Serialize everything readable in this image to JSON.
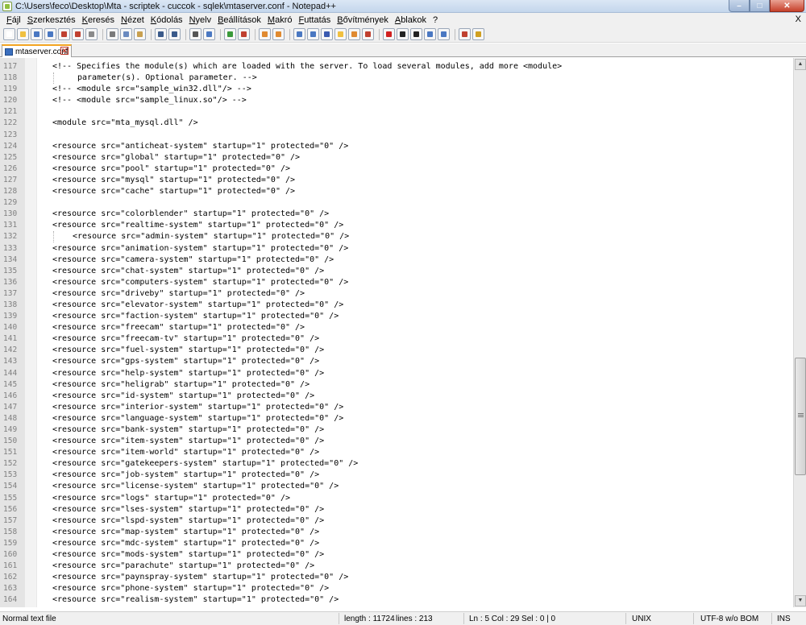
{
  "window": {
    "title": "C:\\Users\\feco\\Desktop\\Mta - scriptek - cuccok - sqlek\\mtaserver.conf - Notepad++",
    "min_glyph": "–",
    "max_glyph": "□",
    "close_glyph": "✕"
  },
  "menu": {
    "items": [
      "Fájl",
      "Szerkesztés",
      "Keresés",
      "Nézet",
      "Kódolás",
      "Nyelv",
      "Beállítások",
      "Makró",
      "Futtatás",
      "Bővítmények",
      "Ablakok",
      "?"
    ],
    "close_label": "X"
  },
  "tab": {
    "label": "mtaserver.conf",
    "close_glyph": "✕"
  },
  "editor": {
    "lines": [
      {
        "n": "117",
        "text": "<!-- Specifies the module(s) which are loaded with the server. To load several modules, add more <module>",
        "style": "code"
      },
      {
        "n": "118",
        "text": "parameter(s). Optional parameter. -->",
        "style": "cont"
      },
      {
        "n": "119",
        "text": "<!-- <module src=\"sample_win32.dll\"/> -->",
        "style": "code"
      },
      {
        "n": "120",
        "text": "<!-- <module src=\"sample_linux.so\"/> -->",
        "style": "code"
      },
      {
        "n": "121",
        "text": "",
        "style": "code"
      },
      {
        "n": "122",
        "text": "<module src=\"mta_mysql.dll\" />",
        "style": "code"
      },
      {
        "n": "123",
        "text": "",
        "style": "code"
      },
      {
        "n": "124",
        "text": "<resource src=\"anticheat-system\" startup=\"1\" protected=\"0\" />",
        "style": "code"
      },
      {
        "n": "125",
        "text": "<resource src=\"global\" startup=\"1\" protected=\"0\" />",
        "style": "code"
      },
      {
        "n": "126",
        "text": "<resource src=\"pool\" startup=\"1\" protected=\"0\" />",
        "style": "code"
      },
      {
        "n": "127",
        "text": "<resource src=\"mysql\" startup=\"1\" protected=\"0\" />",
        "style": "code"
      },
      {
        "n": "128",
        "text": "<resource src=\"cache\" startup=\"1\" protected=\"0\" />",
        "style": "code"
      },
      {
        "n": "129",
        "text": "",
        "style": "code"
      },
      {
        "n": "130",
        "text": "<resource src=\"colorblender\" startup=\"1\" protected=\"0\" />",
        "style": "code"
      },
      {
        "n": "131",
        "text": "<resource src=\"realtime-system\" startup=\"1\" protected=\"0\" />",
        "style": "code"
      },
      {
        "n": "132",
        "text": "<resource src=\"admin-system\" startup=\"1\" protected=\"0\" />",
        "style": "indent"
      },
      {
        "n": "133",
        "text": "<resource src=\"animation-system\" startup=\"1\" protected=\"0\" />",
        "style": "code"
      },
      {
        "n": "134",
        "text": "<resource src=\"camera-system\" startup=\"1\" protected=\"0\" />",
        "style": "code"
      },
      {
        "n": "135",
        "text": "<resource src=\"chat-system\" startup=\"1\" protected=\"0\" />",
        "style": "code"
      },
      {
        "n": "136",
        "text": "<resource src=\"computers-system\" startup=\"1\" protected=\"0\" />",
        "style": "code"
      },
      {
        "n": "137",
        "text": "<resource src=\"driveby\" startup=\"1\" protected=\"0\" />",
        "style": "code"
      },
      {
        "n": "138",
        "text": "<resource src=\"elevator-system\" startup=\"1\" protected=\"0\" />",
        "style": "code"
      },
      {
        "n": "139",
        "text": "<resource src=\"faction-system\" startup=\"1\" protected=\"0\" />",
        "style": "code"
      },
      {
        "n": "140",
        "text": "<resource src=\"freecam\" startup=\"1\" protected=\"0\" />",
        "style": "code"
      },
      {
        "n": "141",
        "text": "<resource src=\"freecam-tv\" startup=\"1\" protected=\"0\" />",
        "style": "code"
      },
      {
        "n": "142",
        "text": "<resource src=\"fuel-system\" startup=\"1\" protected=\"0\" />",
        "style": "code"
      },
      {
        "n": "143",
        "text": "<resource src=\"gps-system\" startup=\"1\" protected=\"0\" />",
        "style": "code"
      },
      {
        "n": "144",
        "text": "<resource src=\"help-system\" startup=\"1\" protected=\"0\" />",
        "style": "code"
      },
      {
        "n": "145",
        "text": "<resource src=\"heligrab\" startup=\"1\" protected=\"0\" />",
        "style": "code"
      },
      {
        "n": "146",
        "text": "<resource src=\"id-system\" startup=\"1\" protected=\"0\" />",
        "style": "code"
      },
      {
        "n": "147",
        "text": "<resource src=\"interior-system\" startup=\"1\" protected=\"0\" />",
        "style": "code"
      },
      {
        "n": "148",
        "text": "<resource src=\"language-system\" startup=\"1\" protected=\"0\" />",
        "style": "code"
      },
      {
        "n": "149",
        "text": "<resource src=\"bank-system\" startup=\"1\" protected=\"0\" />",
        "style": "code"
      },
      {
        "n": "150",
        "text": "<resource src=\"item-system\" startup=\"1\" protected=\"0\" />",
        "style": "code"
      },
      {
        "n": "151",
        "text": "<resource src=\"item-world\" startup=\"1\" protected=\"0\" />",
        "style": "code"
      },
      {
        "n": "152",
        "text": "<resource src=\"gatekeepers-system\" startup=\"1\" protected=\"0\" />",
        "style": "code"
      },
      {
        "n": "153",
        "text": "<resource src=\"job-system\" startup=\"1\" protected=\"0\" />",
        "style": "code"
      },
      {
        "n": "154",
        "text": "<resource src=\"license-system\" startup=\"1\" protected=\"0\" />",
        "style": "code"
      },
      {
        "n": "155",
        "text": "<resource src=\"logs\" startup=\"1\" protected=\"0\" />",
        "style": "code"
      },
      {
        "n": "156",
        "text": "<resource src=\"lses-system\" startup=\"1\" protected=\"0\" />",
        "style": "code"
      },
      {
        "n": "157",
        "text": "<resource src=\"lspd-system\" startup=\"1\" protected=\"0\" />",
        "style": "code"
      },
      {
        "n": "158",
        "text": "<resource src=\"map-system\" startup=\"1\" protected=\"0\" />",
        "style": "code"
      },
      {
        "n": "159",
        "text": "<resource src=\"mdc-system\" startup=\"1\" protected=\"0\" />",
        "style": "code"
      },
      {
        "n": "160",
        "text": "<resource src=\"mods-system\" startup=\"1\" protected=\"0\" />",
        "style": "code"
      },
      {
        "n": "161",
        "text": "<resource src=\"parachute\" startup=\"1\" protected=\"0\" />",
        "style": "code"
      },
      {
        "n": "162",
        "text": "<resource src=\"paynspray-system\" startup=\"1\" protected=\"0\" />",
        "style": "code"
      },
      {
        "n": "163",
        "text": "<resource src=\"phone-system\" startup=\"1\" protected=\"0\" />",
        "style": "code"
      },
      {
        "n": "164",
        "text": "<resource src=\"realism-system\" startup=\"1\" protected=\"0\" />",
        "style": "code"
      }
    ]
  },
  "scrollbar": {
    "up_glyph": "▲",
    "down_glyph": "▼"
  },
  "status": {
    "file_type": "Normal text file",
    "length": "length : 11724",
    "lines": "lines : 213",
    "position": "Ln : 5   Col : 29   Sel : 0 | 0",
    "eol": "UNIX",
    "encoding": "UTF-8 w/o BOM",
    "mode": "INS"
  },
  "toolbar": {
    "icons": [
      {
        "name": "new-file-icon",
        "color": "#ffffff"
      },
      {
        "name": "open-file-icon",
        "color": "#f0c040"
      },
      {
        "name": "save-icon",
        "color": "#4a78c2"
      },
      {
        "name": "save-all-icon",
        "color": "#4a78c2"
      },
      {
        "name": "close-icon",
        "color": "#c04030"
      },
      {
        "name": "close-all-icon",
        "color": "#c04030"
      },
      {
        "name": "print-icon",
        "color": "#8a8a8a"
      },
      {
        "name": "sep",
        "color": ""
      },
      {
        "name": "cut-icon",
        "color": "#7a7a7a"
      },
      {
        "name": "copy-icon",
        "color": "#6a8abf"
      },
      {
        "name": "paste-icon",
        "color": "#c8a050"
      },
      {
        "name": "sep",
        "color": ""
      },
      {
        "name": "undo-icon",
        "color": "#3a5a8a"
      },
      {
        "name": "redo-icon",
        "color": "#3a5a8a"
      },
      {
        "name": "sep",
        "color": ""
      },
      {
        "name": "find-icon",
        "color": "#555555"
      },
      {
        "name": "replace-icon",
        "color": "#4a78c2"
      },
      {
        "name": "sep",
        "color": ""
      },
      {
        "name": "zoom-in-icon",
        "color": "#3a9a3a"
      },
      {
        "name": "zoom-out-icon",
        "color": "#c04030"
      },
      {
        "name": "sep",
        "color": ""
      },
      {
        "name": "sync-vertical-icon",
        "color": "#e08a30"
      },
      {
        "name": "sync-horizontal-icon",
        "color": "#e08a30"
      },
      {
        "name": "sep",
        "color": ""
      },
      {
        "name": "word-wrap-icon",
        "color": "#4a78c2"
      },
      {
        "name": "show-all-chars-icon",
        "color": "#4a78c2"
      },
      {
        "name": "indent-guide-icon",
        "color": "#3a5ab0"
      },
      {
        "name": "user-lang-icon",
        "color": "#f0c040"
      },
      {
        "name": "doc-map-icon",
        "color": "#e08a30"
      },
      {
        "name": "function-list-icon",
        "color": "#c04030"
      },
      {
        "name": "sep",
        "color": ""
      },
      {
        "name": "record-macro-icon",
        "color": "#d02020"
      },
      {
        "name": "stop-macro-icon",
        "color": "#222222"
      },
      {
        "name": "play-macro-icon",
        "color": "#222222"
      },
      {
        "name": "run-macro-multiple-icon",
        "color": "#4a78c2"
      },
      {
        "name": "save-macro-icon",
        "color": "#4a78c2"
      },
      {
        "name": "sep",
        "color": ""
      },
      {
        "name": "spell-check-icon",
        "color": "#c04030"
      },
      {
        "name": "spell-auto-icon",
        "color": "#d0a020"
      }
    ]
  }
}
